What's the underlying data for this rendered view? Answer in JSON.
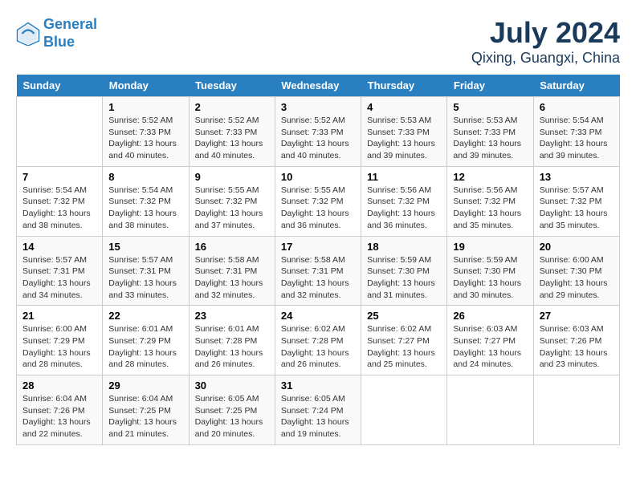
{
  "header": {
    "logo_line1": "General",
    "logo_line2": "Blue",
    "title": "July 2024",
    "subtitle": "Qixing, Guangxi, China"
  },
  "days_of_week": [
    "Sunday",
    "Monday",
    "Tuesday",
    "Wednesday",
    "Thursday",
    "Friday",
    "Saturday"
  ],
  "weeks": [
    [
      {
        "day": "",
        "sunrise": "",
        "sunset": "",
        "daylight": ""
      },
      {
        "day": "1",
        "sunrise": "Sunrise: 5:52 AM",
        "sunset": "Sunset: 7:33 PM",
        "daylight": "Daylight: 13 hours and 40 minutes."
      },
      {
        "day": "2",
        "sunrise": "Sunrise: 5:52 AM",
        "sunset": "Sunset: 7:33 PM",
        "daylight": "Daylight: 13 hours and 40 minutes."
      },
      {
        "day": "3",
        "sunrise": "Sunrise: 5:52 AM",
        "sunset": "Sunset: 7:33 PM",
        "daylight": "Daylight: 13 hours and 40 minutes."
      },
      {
        "day": "4",
        "sunrise": "Sunrise: 5:53 AM",
        "sunset": "Sunset: 7:33 PM",
        "daylight": "Daylight: 13 hours and 39 minutes."
      },
      {
        "day": "5",
        "sunrise": "Sunrise: 5:53 AM",
        "sunset": "Sunset: 7:33 PM",
        "daylight": "Daylight: 13 hours and 39 minutes."
      },
      {
        "day": "6",
        "sunrise": "Sunrise: 5:54 AM",
        "sunset": "Sunset: 7:33 PM",
        "daylight": "Daylight: 13 hours and 39 minutes."
      }
    ],
    [
      {
        "day": "7",
        "sunrise": "Sunrise: 5:54 AM",
        "sunset": "Sunset: 7:32 PM",
        "daylight": "Daylight: 13 hours and 38 minutes."
      },
      {
        "day": "8",
        "sunrise": "Sunrise: 5:54 AM",
        "sunset": "Sunset: 7:32 PM",
        "daylight": "Daylight: 13 hours and 38 minutes."
      },
      {
        "day": "9",
        "sunrise": "Sunrise: 5:55 AM",
        "sunset": "Sunset: 7:32 PM",
        "daylight": "Daylight: 13 hours and 37 minutes."
      },
      {
        "day": "10",
        "sunrise": "Sunrise: 5:55 AM",
        "sunset": "Sunset: 7:32 PM",
        "daylight": "Daylight: 13 hours and 36 minutes."
      },
      {
        "day": "11",
        "sunrise": "Sunrise: 5:56 AM",
        "sunset": "Sunset: 7:32 PM",
        "daylight": "Daylight: 13 hours and 36 minutes."
      },
      {
        "day": "12",
        "sunrise": "Sunrise: 5:56 AM",
        "sunset": "Sunset: 7:32 PM",
        "daylight": "Daylight: 13 hours and 35 minutes."
      },
      {
        "day": "13",
        "sunrise": "Sunrise: 5:57 AM",
        "sunset": "Sunset: 7:32 PM",
        "daylight": "Daylight: 13 hours and 35 minutes."
      }
    ],
    [
      {
        "day": "14",
        "sunrise": "Sunrise: 5:57 AM",
        "sunset": "Sunset: 7:31 PM",
        "daylight": "Daylight: 13 hours and 34 minutes."
      },
      {
        "day": "15",
        "sunrise": "Sunrise: 5:57 AM",
        "sunset": "Sunset: 7:31 PM",
        "daylight": "Daylight: 13 hours and 33 minutes."
      },
      {
        "day": "16",
        "sunrise": "Sunrise: 5:58 AM",
        "sunset": "Sunset: 7:31 PM",
        "daylight": "Daylight: 13 hours and 32 minutes."
      },
      {
        "day": "17",
        "sunrise": "Sunrise: 5:58 AM",
        "sunset": "Sunset: 7:31 PM",
        "daylight": "Daylight: 13 hours and 32 minutes."
      },
      {
        "day": "18",
        "sunrise": "Sunrise: 5:59 AM",
        "sunset": "Sunset: 7:30 PM",
        "daylight": "Daylight: 13 hours and 31 minutes."
      },
      {
        "day": "19",
        "sunrise": "Sunrise: 5:59 AM",
        "sunset": "Sunset: 7:30 PM",
        "daylight": "Daylight: 13 hours and 30 minutes."
      },
      {
        "day": "20",
        "sunrise": "Sunrise: 6:00 AM",
        "sunset": "Sunset: 7:30 PM",
        "daylight": "Daylight: 13 hours and 29 minutes."
      }
    ],
    [
      {
        "day": "21",
        "sunrise": "Sunrise: 6:00 AM",
        "sunset": "Sunset: 7:29 PM",
        "daylight": "Daylight: 13 hours and 28 minutes."
      },
      {
        "day": "22",
        "sunrise": "Sunrise: 6:01 AM",
        "sunset": "Sunset: 7:29 PM",
        "daylight": "Daylight: 13 hours and 28 minutes."
      },
      {
        "day": "23",
        "sunrise": "Sunrise: 6:01 AM",
        "sunset": "Sunset: 7:28 PM",
        "daylight": "Daylight: 13 hours and 26 minutes."
      },
      {
        "day": "24",
        "sunrise": "Sunrise: 6:02 AM",
        "sunset": "Sunset: 7:28 PM",
        "daylight": "Daylight: 13 hours and 26 minutes."
      },
      {
        "day": "25",
        "sunrise": "Sunrise: 6:02 AM",
        "sunset": "Sunset: 7:27 PM",
        "daylight": "Daylight: 13 hours and 25 minutes."
      },
      {
        "day": "26",
        "sunrise": "Sunrise: 6:03 AM",
        "sunset": "Sunset: 7:27 PM",
        "daylight": "Daylight: 13 hours and 24 minutes."
      },
      {
        "day": "27",
        "sunrise": "Sunrise: 6:03 AM",
        "sunset": "Sunset: 7:26 PM",
        "daylight": "Daylight: 13 hours and 23 minutes."
      }
    ],
    [
      {
        "day": "28",
        "sunrise": "Sunrise: 6:04 AM",
        "sunset": "Sunset: 7:26 PM",
        "daylight": "Daylight: 13 hours and 22 minutes."
      },
      {
        "day": "29",
        "sunrise": "Sunrise: 6:04 AM",
        "sunset": "Sunset: 7:25 PM",
        "daylight": "Daylight: 13 hours and 21 minutes."
      },
      {
        "day": "30",
        "sunrise": "Sunrise: 6:05 AM",
        "sunset": "Sunset: 7:25 PM",
        "daylight": "Daylight: 13 hours and 20 minutes."
      },
      {
        "day": "31",
        "sunrise": "Sunrise: 6:05 AM",
        "sunset": "Sunset: 7:24 PM",
        "daylight": "Daylight: 13 hours and 19 minutes."
      },
      {
        "day": "",
        "sunrise": "",
        "sunset": "",
        "daylight": ""
      },
      {
        "day": "",
        "sunrise": "",
        "sunset": "",
        "daylight": ""
      },
      {
        "day": "",
        "sunrise": "",
        "sunset": "",
        "daylight": ""
      }
    ]
  ]
}
